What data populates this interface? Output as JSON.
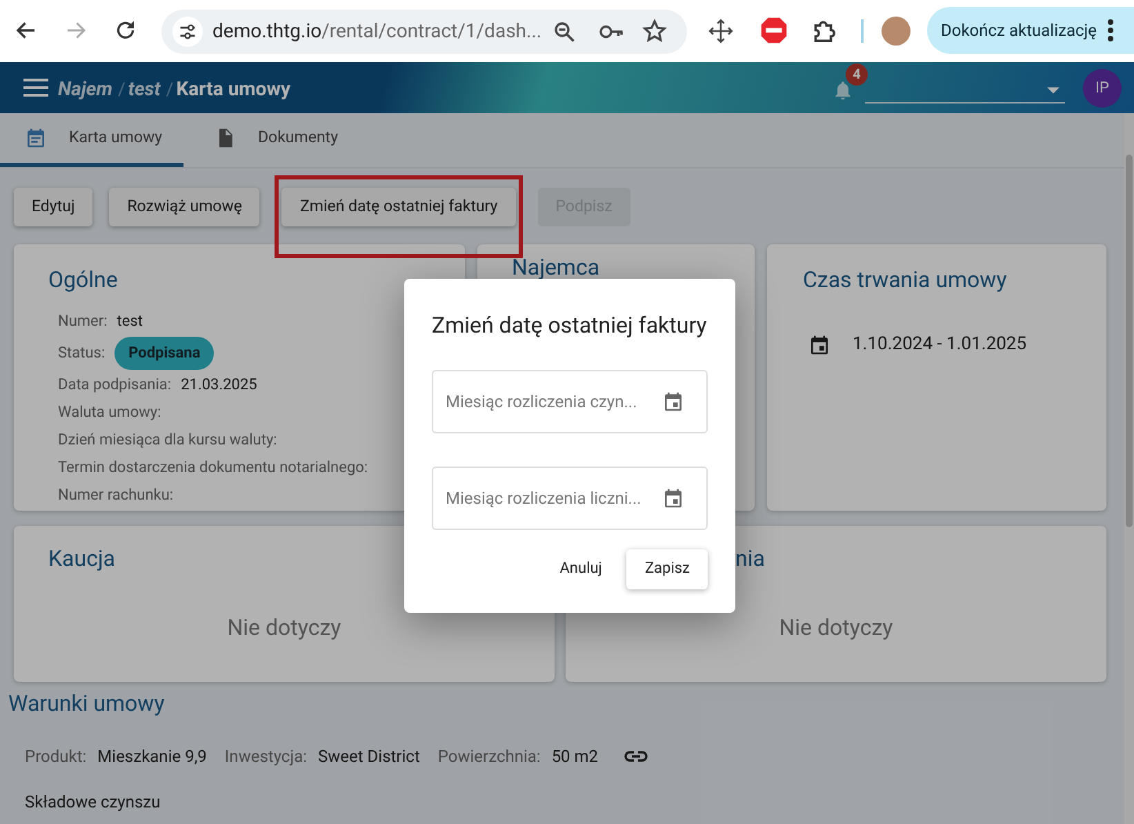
{
  "browser": {
    "url_host": "demo.thtg.io",
    "url_path": "/rental/contract/1/dash...",
    "update_button": "Dokończ aktualizację"
  },
  "header": {
    "separator": "/",
    "breadcrumb": [
      {
        "label": "Najem",
        "current": false
      },
      {
        "label": "test",
        "current": false
      },
      {
        "label": "Karta umowy",
        "current": true
      }
    ],
    "notification_count": "4",
    "avatar": "IP"
  },
  "tabs": [
    {
      "label": "Karta umowy",
      "selected": true,
      "kind": "contract"
    },
    {
      "label": "Dokumenty",
      "selected": false,
      "kind": "document"
    }
  ],
  "actions": [
    {
      "label": "Edytuj",
      "disabled": false,
      "highlighted": false
    },
    {
      "label": "Rozwiąż umowę",
      "disabled": false,
      "highlighted": false
    },
    {
      "label": "Zmień datę ostatniej faktury",
      "disabled": false,
      "highlighted": true
    },
    {
      "label": "Podpisz",
      "disabled": true,
      "highlighted": false
    }
  ],
  "general": {
    "title": "Ogólne",
    "fields": [
      {
        "label": "Numer:",
        "value": "test",
        "kind": "text"
      },
      {
        "label": "Status:",
        "value": "Podpisana",
        "kind": "badge"
      },
      {
        "label": "Data podpisania:",
        "value": "21.03.2025",
        "kind": "text"
      },
      {
        "label": "Waluta umowy:",
        "kind": "text"
      },
      {
        "label": "Dzień miesiąca dla kursu waluty:",
        "kind": "text"
      },
      {
        "label": "Termin dostarczenia dokumentu notarialnego:",
        "kind": "text"
      },
      {
        "label": "Numer rachunku:",
        "kind": "text"
      }
    ]
  },
  "tenant": {
    "title": "Najemca"
  },
  "duration": {
    "title": "Czas trwania umowy",
    "range": "1.10.2024 - 1.01.2025"
  },
  "deposit": {
    "title": "Kaucja",
    "value": "Nie dotyczy"
  },
  "second_card": {
    "title": "nia",
    "value": "Nie dotyczy"
  },
  "terms": {
    "title": "Warunki umowy",
    "details": [
      {
        "label": "Produkt:",
        "value": "Mieszkanie 9,9"
      },
      {
        "label": "Inwestycja:",
        "value": "Sweet District"
      },
      {
        "label": "Powierzchnia:",
        "value": "50 m2"
      }
    ],
    "subtitle": "Składowe czynszu"
  },
  "dialog": {
    "title": "Zmień datę ostatniej faktury",
    "fields": [
      {
        "placeholder": "Miesiąc rozliczenia czyn..."
      },
      {
        "placeholder": "Miesiąc rozliczenia liczni..."
      }
    ],
    "cancel": "Anuluj",
    "save": "Zapisz"
  }
}
